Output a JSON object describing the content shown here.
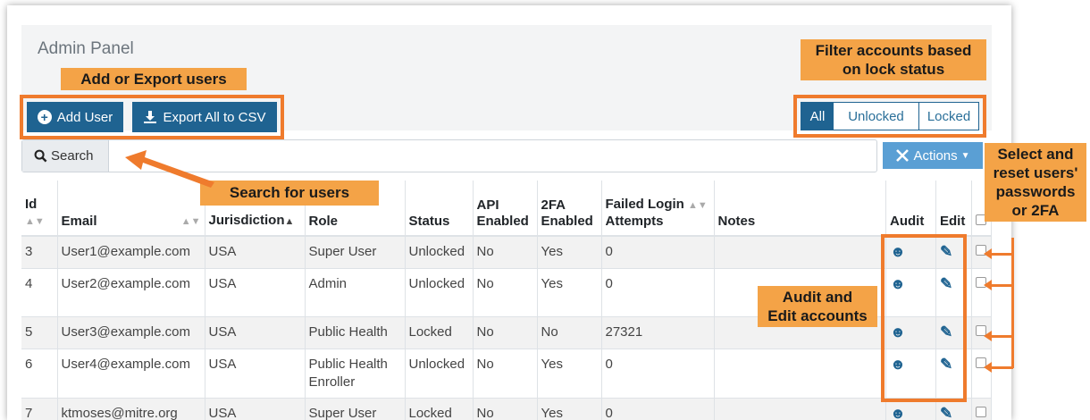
{
  "panel": {
    "title": "Admin Panel"
  },
  "toolbar": {
    "add_user_label": "Add User",
    "export_label": "Export All to CSV",
    "filter_all": "All",
    "filter_unlocked": "Unlocked",
    "filter_locked": "Locked",
    "actions_label": "Actions"
  },
  "search": {
    "addon_label": "Search",
    "placeholder": ""
  },
  "table": {
    "headers": {
      "id": "Id",
      "email": "Email",
      "jurisdiction": "Jurisdiction",
      "role": "Role",
      "status": "Status",
      "api1": "API",
      "api2": "Enabled",
      "tfa1": "2FA",
      "tfa2": "Enabled",
      "failed1": "Failed Login",
      "failed2": "Attempts",
      "notes": "Notes",
      "audit": "Audit",
      "edit": "Edit"
    },
    "rows": [
      {
        "id": "3",
        "email": "User1@example.com",
        "jurisdiction": "USA",
        "role": "Super User",
        "role2": "",
        "status": "Unlocked",
        "api": "No",
        "tfa": "Yes",
        "failed": "0",
        "notes": ""
      },
      {
        "id": "4",
        "email": "User2@example.com",
        "jurisdiction": "USA",
        "role": "Admin",
        "role2": "",
        "status": "Unlocked",
        "api": "No",
        "tfa": "Yes",
        "failed": "0",
        "notes": ""
      },
      {
        "id": "5",
        "email": "User3@example.com",
        "jurisdiction": "USA",
        "role": "Public Health",
        "role2": "",
        "status": "Locked",
        "api": "No",
        "tfa": "No",
        "failed": "27321",
        "notes": ""
      },
      {
        "id": "6",
        "email": "User4@example.com",
        "jurisdiction": "USA",
        "role": "Public Health",
        "role2": "Enroller",
        "status": "Unlocked",
        "api": "No",
        "tfa": "Yes",
        "failed": "0",
        "notes": ""
      },
      {
        "id": "7",
        "email": "ktmoses@mitre.org",
        "jurisdiction": "USA",
        "role": "Super User",
        "role2": "",
        "status": "Locked",
        "api": "No",
        "tfa": "Yes",
        "failed": "0",
        "notes": ""
      }
    ]
  },
  "annotations": {
    "add_export": "Add or Export users",
    "filter_line1": "Filter accounts based",
    "filter_line2": "on lock status",
    "search": "Search for users",
    "audit_line1": "Audit and",
    "audit_line2": "Edit accounts",
    "select_line1": "Select and",
    "select_line2": "reset users'",
    "select_line3": "passwords",
    "select_line4": "or 2FA"
  },
  "colors": {
    "primary": "#1f6391",
    "actions": "#5a9fd4",
    "annotation_border": "#ef7b2d",
    "annotation_fill": "#f4a347"
  }
}
